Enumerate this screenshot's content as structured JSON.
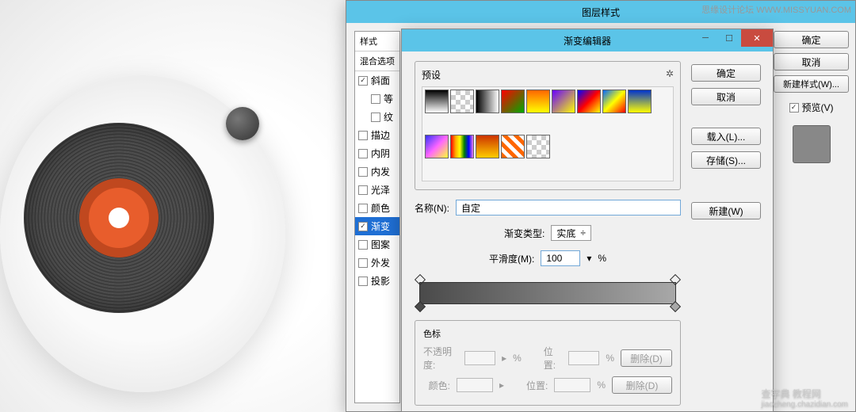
{
  "watermarks": {
    "top": "思缘设计论坛  WWW.MISSYUAN.COM",
    "bottom_main": "查字典 教程网",
    "bottom_sub": "jiaocheng.chazidian.com"
  },
  "layer_style": {
    "title": "图层样式",
    "sidebar": {
      "style_header": "样式",
      "blend_header": "混合选项",
      "items": [
        {
          "label": "斜面",
          "checked": true
        },
        {
          "label": "等",
          "checked": false
        },
        {
          "label": "纹",
          "checked": false
        },
        {
          "label": "描边",
          "checked": false
        },
        {
          "label": "内阴",
          "checked": false
        },
        {
          "label": "内发",
          "checked": false
        },
        {
          "label": "光泽",
          "checked": false
        },
        {
          "label": "颜色",
          "checked": false
        },
        {
          "label": "渐变",
          "checked": true,
          "selected": true
        },
        {
          "label": "图案",
          "checked": false
        },
        {
          "label": "外发",
          "checked": false
        },
        {
          "label": "投影",
          "checked": false
        }
      ]
    },
    "buttons": {
      "ok": "确定",
      "cancel": "取消",
      "new_style": "新建样式(W)...",
      "preview": "预览(V)"
    }
  },
  "gradient_editor": {
    "title": "渐变编辑器",
    "presets_label": "预设",
    "gear_icon": "✲",
    "name_label": "名称(N):",
    "name_value": "自定",
    "new_btn": "新建(W)",
    "type_label": "渐变类型:",
    "type_value": "实底",
    "smooth_label": "平滑度(M):",
    "smooth_value": "100",
    "percent": "%",
    "sebiao_label": "色标",
    "opacity_label": "不透明度:",
    "position_label": "位置:",
    "color_label": "颜色:",
    "delete_btn": "删除(D)",
    "buttons": {
      "ok": "确定",
      "cancel": "取消",
      "load": "载入(L)...",
      "save": "存储(S)..."
    }
  }
}
